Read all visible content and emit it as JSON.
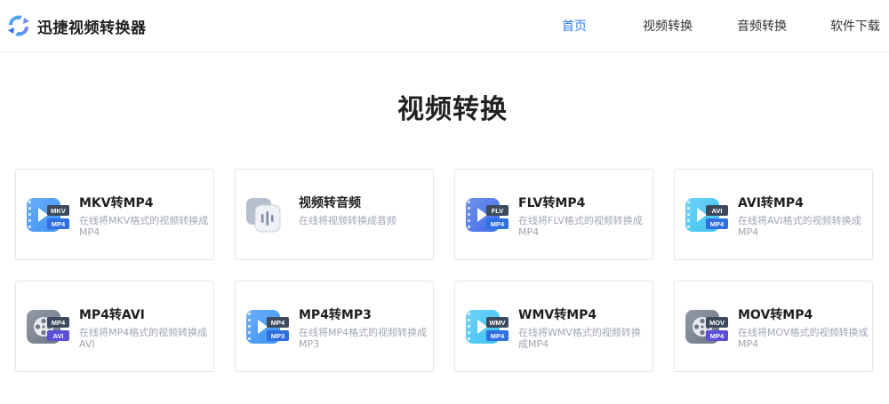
{
  "app": {
    "name": "迅捷视频转换器"
  },
  "nav": {
    "items": [
      {
        "label": "首页"
      },
      {
        "label": "视频转换"
      },
      {
        "label": "音频转换"
      },
      {
        "label": "软件下载"
      }
    ],
    "active_color": "#2f7cf6"
  },
  "main": {
    "title": "视频转换"
  },
  "tools": [
    {
      "title": "MKV转MP4",
      "desc": "在线将MKV格式的视频转换成MP4",
      "icon": "video-icon",
      "badge_top": "MKV",
      "badge_bottom": "MP4",
      "color": "#3b93f5"
    },
    {
      "title": "视频转音频",
      "desc": "在线将视频转换成音频",
      "icon": "audio-wave-icon",
      "badge_top": "",
      "badge_bottom": "",
      "color": "#9fa9ba"
    },
    {
      "title": "FLV转MP4",
      "desc": "在线将FLV格式的视频转换成MP4",
      "icon": "video-icon",
      "badge_top": "FLV",
      "badge_bottom": "MP4",
      "color": "#3f6de8"
    },
    {
      "title": "AVI转MP4",
      "desc": "在线将AVI格式的视频转换成MP4",
      "icon": "video-icon",
      "badge_top": "AVI",
      "badge_bottom": "MP4",
      "color": "#3fc3f3"
    },
    {
      "title": "MP4转AVI",
      "desc": "在线将MP4格式的视频转换成AVI",
      "icon": "film-reel-icon",
      "badge_top": "MP4",
      "badge_bottom": "AVI",
      "color": "#6e7786"
    },
    {
      "title": "MP4转MP3",
      "desc": "在线将MP4格式的视频转换成MP3",
      "icon": "video-icon",
      "badge_top": "MP4",
      "badge_bottom": "MP3",
      "color": "#3b93f5"
    },
    {
      "title": "WMV转MP4",
      "desc": "在线将WMV格式的视频转换成MP4",
      "icon": "video-icon",
      "badge_top": "WMV",
      "badge_bottom": "MP4",
      "color": "#3fc3f3"
    },
    {
      "title": "MOV转MP4",
      "desc": "在线将MOV格式的视频转换成MP4",
      "icon": "film-reel-icon",
      "badge_top": "MOV",
      "badge_bottom": "MP4",
      "color": "#6e7786"
    }
  ]
}
